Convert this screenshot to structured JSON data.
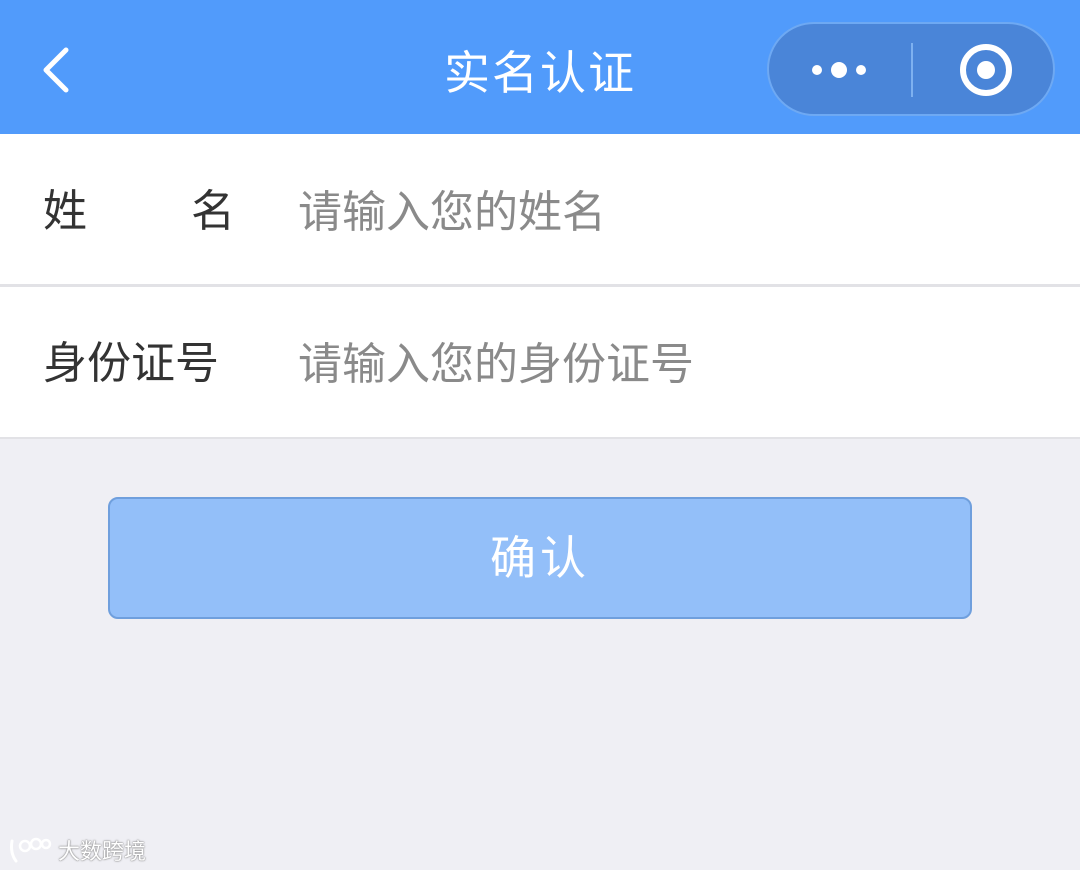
{
  "navbar": {
    "title": "实名认证",
    "background_color": "#519bfb",
    "back_icon": "chevron-left-icon",
    "more_icon": "more-dots-icon",
    "close_icon": "target-circle-icon"
  },
  "form": {
    "name_label": "姓名",
    "name_placeholder": "请输入您的姓名",
    "name_value": "",
    "id_label": "身份证号",
    "id_placeholder": "请输入您的身份证号",
    "id_value": ""
  },
  "confirm_label": "确认",
  "confirm_color": "#93bff9",
  "watermark": {
    "text": "大数跨境",
    "logo": "dashu-logo-icon"
  }
}
